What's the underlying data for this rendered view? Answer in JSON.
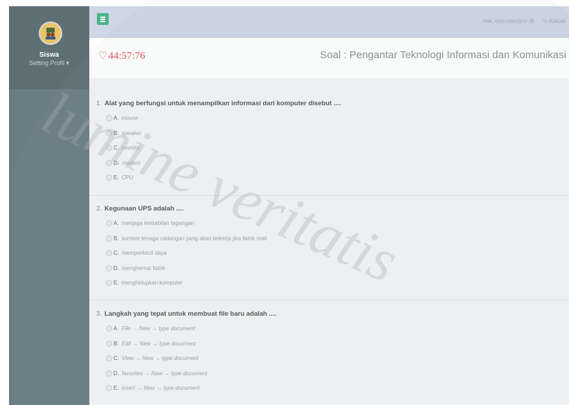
{
  "sidebar": {
    "user_name": "Siswa",
    "setting_label": "Setting Profil ▾"
  },
  "topbar": {
    "greeting": "Hai, eno maniyur ⚙",
    "logout_label": "↪ Keluar"
  },
  "exam": {
    "timer": "44:57:76",
    "title": "Soal : Pengantar Teknologi Informasi dan Komunikasi"
  },
  "questions": [
    {
      "number": "1.",
      "text": "Alat yang berfungsi untuk menampilkan informasi dari komputer disebut ....",
      "options": [
        {
          "letter": "A.",
          "text": "mouse"
        },
        {
          "letter": "B.",
          "text": "speaker"
        },
        {
          "letter": "C.",
          "text": "monitor"
        },
        {
          "letter": "D.",
          "text": "modem"
        },
        {
          "letter": "E.",
          "text": "CPU"
        }
      ]
    },
    {
      "number": "2.",
      "text": "Kegunaan UPS adalah ....",
      "options": [
        {
          "letter": "A.",
          "text": "menjaga kestabilan tegangan"
        },
        {
          "letter": "B.",
          "text": "sumber tenaga cadangan yang akan bekerja jika listrik mati"
        },
        {
          "letter": "C.",
          "text": "memperkecil daya"
        },
        {
          "letter": "D.",
          "text": "menghemat listrik"
        },
        {
          "letter": "E.",
          "text": "menghidupkan komputer"
        }
      ]
    },
    {
      "number": "3.",
      "text": "Langkah yang tepat untuk membuat file baru adalah ....",
      "options": [
        {
          "letter": "A.",
          "text": "File → New → type document"
        },
        {
          "letter": "B.",
          "text": "Edit → New → type document"
        },
        {
          "letter": "C.",
          "text": "View → New → type document"
        },
        {
          "letter": "D.",
          "text": "favorites → New → type document"
        },
        {
          "letter": "E.",
          "text": "insert → New → type document"
        }
      ]
    }
  ],
  "watermark": "lumine veritatis",
  "colors": {
    "sidebar": "#6b7d84",
    "topbar": "#cfd6e6",
    "menu_button": "#4db38a",
    "timer": "#e04b4b"
  }
}
